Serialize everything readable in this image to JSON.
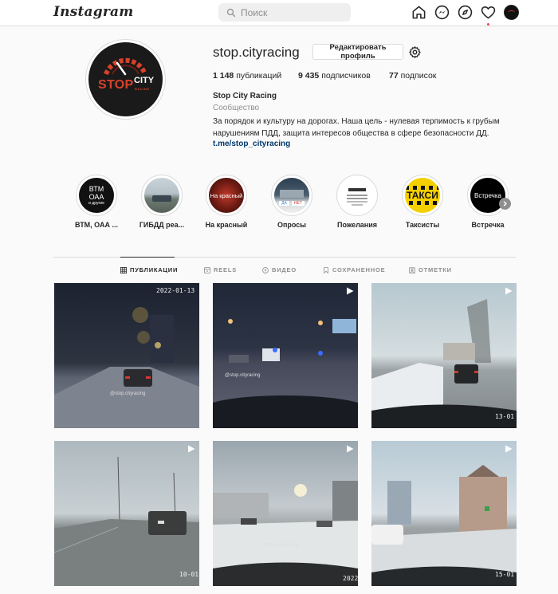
{
  "nav": {
    "logo": "Instagram",
    "search_placeholder": "Поиск",
    "icons": [
      "home-icon",
      "messenger-icon",
      "explore-icon",
      "heart-icon",
      "avatar"
    ]
  },
  "profile": {
    "username": "stop.cityracing",
    "edit_button": "Редактировать профиль",
    "stats": {
      "posts_count": "1 148",
      "posts_label": "публикаций",
      "followers_count": "9 435",
      "followers_label": "подписчиков",
      "following_count": "77",
      "following_label": "подписок"
    },
    "full_name": "Stop City Racing",
    "category": "Сообщество",
    "bio": "За порядок и культуру на дорогах. Наша цель - нулевая терпимость к грубым нарушениям ПДД, защита интересов общества в сфере безопасности ДД.",
    "link": "t.me/stop_cityracing",
    "avatar_logo": {
      "stop": "STOP",
      "city": "CITY",
      "racing": "RACING"
    }
  },
  "highlights": [
    {
      "label": "ВТМ, ОАА ...",
      "inner": [
        "ВТМ",
        "ОАА",
        "и другие"
      ]
    },
    {
      "label": "ГИБДД реа..."
    },
    {
      "label": "На красный",
      "inner": [
        "На красный"
      ]
    },
    {
      "label": "Опросы",
      "inner": [
        "ДА",
        "НЕТ"
      ]
    },
    {
      "label": "Пожелания"
    },
    {
      "label": "Таксисты",
      "inner": [
        "ТАКСИ"
      ]
    },
    {
      "label": "Встречка",
      "inner": [
        "Встречка"
      ]
    }
  ],
  "tabs": [
    {
      "label": "ПУБЛИКАЦИИ",
      "active": true
    },
    {
      "label": "REELS",
      "active": false
    },
    {
      "label": "ВИДЕО",
      "active": false
    },
    {
      "label": "СОХРАНЕННОЕ",
      "active": false
    },
    {
      "label": "ОТМЕТКИ",
      "active": false
    }
  ],
  "posts": [
    {
      "stamp": "2022-01-13",
      "watermark": "@stop.cityracing"
    },
    {
      "watermark": "@stop.cityracing"
    },
    {
      "stamp": "13-01"
    },
    {
      "stamp": "10-01"
    },
    {
      "watermark": "@stop.cityracing",
      "stamp": "2022"
    },
    {
      "stamp": "15-01"
    }
  ],
  "colors": {
    "accent_red": "#d9412b",
    "link_blue": "#00376b",
    "notification_red": "#ed4956"
  }
}
